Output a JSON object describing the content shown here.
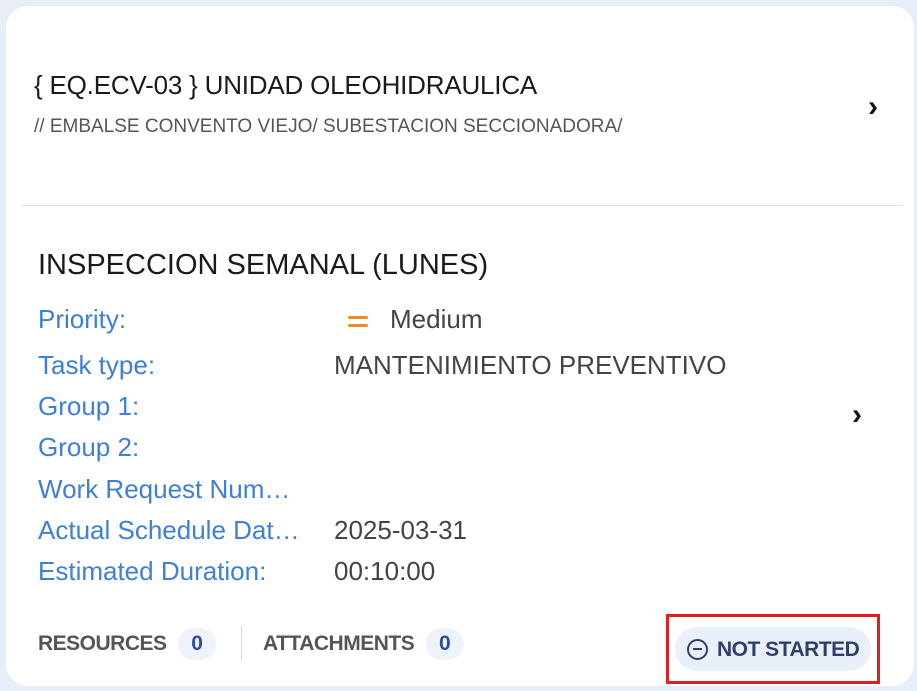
{
  "equipment": {
    "title": "{ EQ.ECV-03 } UNIDAD OLEOHIDRAULICA",
    "path": "// EMBALSE CONVENTO VIEJO/ SUBESTACION SECCIONADORA/"
  },
  "task": {
    "title": "INSPECCION SEMANAL (LUNES)",
    "fields": {
      "priority_label": "Priority:",
      "priority_value": "Medium",
      "task_type_label": "Task type:",
      "task_type_value": "MANTENIMIENTO PREVENTIVO",
      "group1_label": "Group 1:",
      "group1_value": "",
      "group2_label": "Group 2:",
      "group2_value": "",
      "work_request_label": "Work Request Num…",
      "work_request_value": "",
      "schedule_label": "Actual Schedule Dat…",
      "schedule_value": "2025-03-31",
      "duration_label": "Estimated Duration:",
      "duration_value": "00:10:00"
    }
  },
  "footer": {
    "resources_label": "RESOURCES",
    "resources_count": "0",
    "attachments_label": "ATTACHMENTS",
    "attachments_count": "0",
    "status_label": "NOT STARTED"
  },
  "icons": {
    "chevron": "chevron-right-icon",
    "priority": "priority-medium-icon",
    "status": "minus-circle-icon"
  },
  "colors": {
    "label_blue": "#3d7fd9",
    "priority_orange": "#f08a24",
    "highlight_red": "#e0201e"
  }
}
